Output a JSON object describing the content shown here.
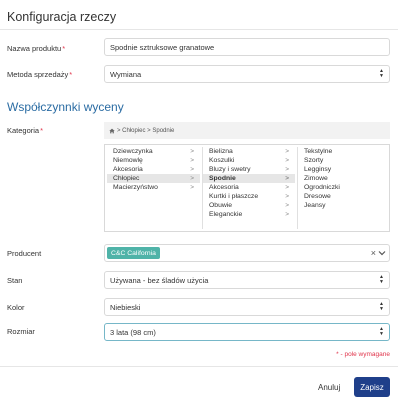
{
  "modal": {
    "title": "Konfiguracja rzeczy"
  },
  "form": {
    "product_name": {
      "label": "Nazwa produktu",
      "required_mark": "*",
      "value": "Spodnie sztruksowe granatowe"
    },
    "sale_method": {
      "label": "Metoda sprzedaży",
      "required_mark": "*",
      "value": "Wymiana"
    }
  },
  "section": {
    "title": "Współczynnki wyceny"
  },
  "category": {
    "label": "Kategoria",
    "required_mark": "*",
    "breadcrumb": "> Chłopiec > Spodnie",
    "col1": [
      {
        "label": "Dziewczynka",
        "arrow": ">"
      },
      {
        "label": "Niemowlę",
        "arrow": ">"
      },
      {
        "label": "Akcesoria",
        "arrow": ">"
      },
      {
        "label": "Chłopiec",
        "arrow": ">"
      },
      {
        "label": "Macierzyństwo",
        "arrow": ">"
      }
    ],
    "col2": [
      {
        "label": "Bielizna",
        "arrow": ">"
      },
      {
        "label": "Koszulki",
        "arrow": ">"
      },
      {
        "label": "Bluzy i swetry",
        "arrow": ">"
      },
      {
        "label": "Spodnie",
        "arrow": ">"
      },
      {
        "label": "Akcesoria",
        "arrow": ">"
      },
      {
        "label": "Kurtki i płaszcze",
        "arrow": ">"
      },
      {
        "label": "Obuwie",
        "arrow": ">"
      },
      {
        "label": "Eleganckie",
        "arrow": ">"
      }
    ],
    "col3": [
      {
        "label": "Tekstylne"
      },
      {
        "label": "Szorty"
      },
      {
        "label": "Legginsy"
      },
      {
        "label": "Zimowe"
      },
      {
        "label": "Ogrodniczki"
      },
      {
        "label": "Dresowe"
      },
      {
        "label": "Jeansy"
      }
    ]
  },
  "producer": {
    "label": "Producent",
    "tag": "C&C California",
    "clear": "×"
  },
  "condition": {
    "label": "Stan",
    "value": "Używana - bez śladów użycia"
  },
  "color": {
    "label": "Kolor",
    "value": "Niebieski"
  },
  "size": {
    "label": "Rozmiar",
    "value": "3 lata (98 cm)"
  },
  "required_note": "* - pole wymagane",
  "buttons": {
    "cancel": "Anuluj",
    "save": "Zapisz"
  }
}
